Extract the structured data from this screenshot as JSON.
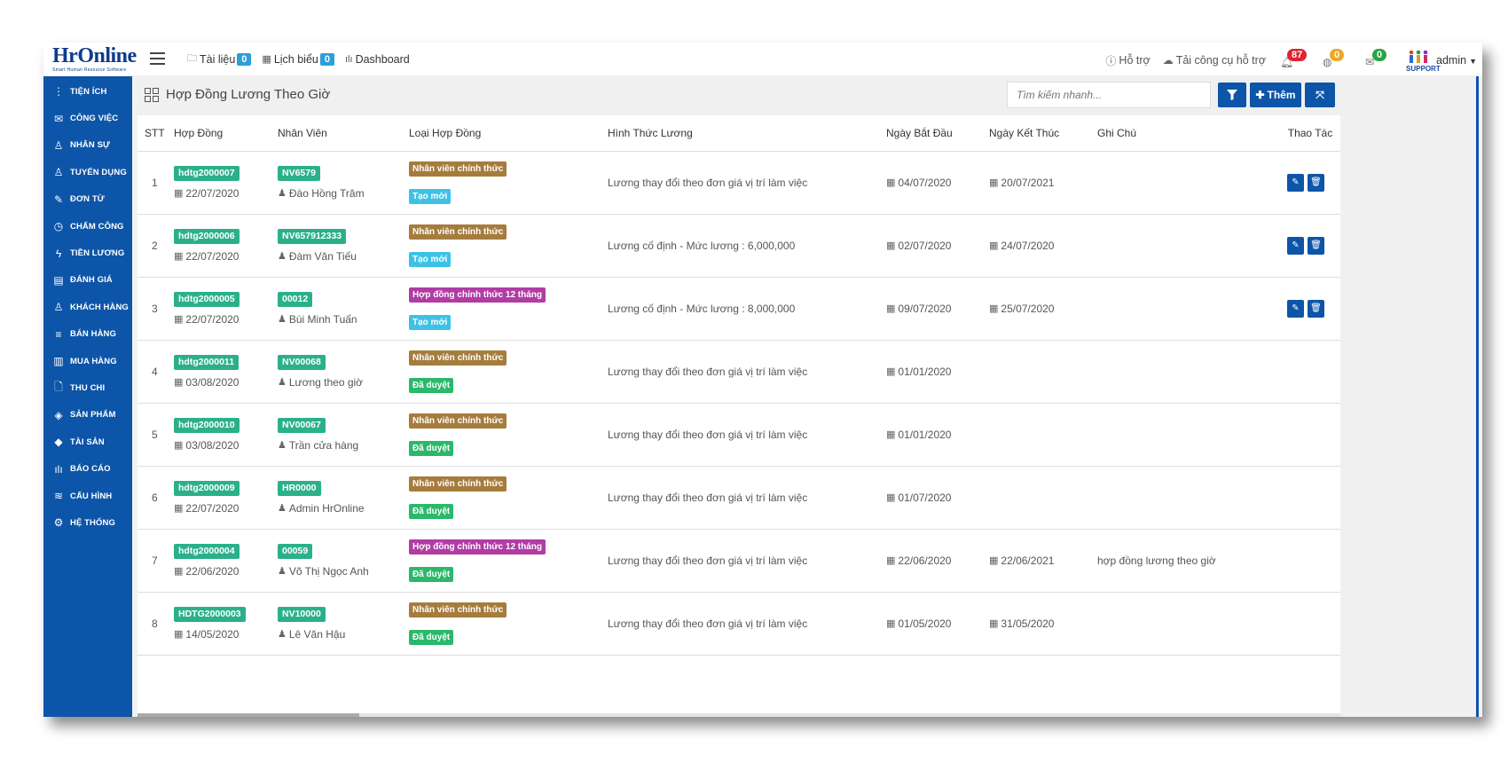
{
  "app": {
    "logo_text": "HrOnline",
    "logo_tagline": "Smart Human Resource Software"
  },
  "topnav": {
    "documents_label": "Tài liệu",
    "documents_count": "0",
    "forms_label": "Lịch biểu",
    "forms_count": "0",
    "dashboard_label": "Dashboard"
  },
  "topright": {
    "help_label": "Hỗ trợ",
    "tools_label": "Tải công cụ hỗ trợ",
    "notifications_count": "87",
    "globe_count": "0",
    "mail_count": "0",
    "support_label": "SUPPORT",
    "user_label": "admin"
  },
  "colors": {
    "brand": "#0d55a8",
    "badge_code": "#2bb08a",
    "badge_official": "#a67c3d",
    "badge_contract12": "#b03ca4",
    "badge_new": "#3ec1e5",
    "badge_approved": "#2bb86a",
    "notif_red": "#e0242f",
    "notif_orange": "#f0a722",
    "notif_green": "#27a642"
  },
  "sidebar": {
    "items": [
      {
        "label": "Tiện ích",
        "icon": "vertical-dots-icon"
      },
      {
        "label": "Công việc",
        "icon": "inbox-icon"
      },
      {
        "label": "Nhân sự",
        "icon": "user-icon"
      },
      {
        "label": "Tuyển dụng",
        "icon": "user-add-icon"
      },
      {
        "label": "Đơn từ",
        "icon": "edit-icon"
      },
      {
        "label": "Chấm công",
        "icon": "clock-icon"
      },
      {
        "label": "Tiền lương",
        "icon": "bolt-icon"
      },
      {
        "label": "Đánh giá",
        "icon": "book-icon"
      },
      {
        "label": "Khách hàng",
        "icon": "customer-icon"
      },
      {
        "label": "Bán hàng",
        "icon": "list-icon"
      },
      {
        "label": "Mua hàng",
        "icon": "map-icon"
      },
      {
        "label": "Thu chi",
        "icon": "file-icon"
      },
      {
        "label": "Sản phẩm",
        "icon": "tag-icon"
      },
      {
        "label": "Tài sản",
        "icon": "diamond-icon"
      },
      {
        "label": "Báo cáo",
        "icon": "bar-chart-icon"
      },
      {
        "label": "Cấu hình",
        "icon": "layers-icon"
      },
      {
        "label": "Hệ thống",
        "icon": "gear-icon"
      }
    ]
  },
  "page": {
    "title": "Hợp Đồng Lương Theo Giờ",
    "search_placeholder": "Tìm kiếm nhanh...",
    "add_label": "Thêm"
  },
  "table": {
    "headers": [
      "STT",
      "Hợp Đồng",
      "Nhân Viên",
      "Loại Hợp Đồng",
      "Hình Thức Lương",
      "Ngày Bắt Đầu",
      "Ngày Kết Thúc",
      "Ghi Chú",
      "Thao Tác"
    ],
    "rows": [
      {
        "stt": "1",
        "contract": "hdtg2000007",
        "contract_date": "22/07/2020",
        "emp_code": "NV6579",
        "emp_name": "Đào Hồng Trâm",
        "type": "Nhân viên chính thức",
        "type_kind": "official",
        "status": "Tạo mới",
        "status_kind": "new",
        "salary": "Lương thay đổi theo đơn giá vị trí làm việc",
        "start": "04/07/2020",
        "end": "20/07/2021",
        "note": "",
        "actions": true
      },
      {
        "stt": "2",
        "contract": "hdtg2000006",
        "contract_date": "22/07/2020",
        "emp_code": "NV657912333",
        "emp_name": "Đàm Văn Tiếu",
        "type": "Nhân viên chính thức",
        "type_kind": "official",
        "status": "Tạo mới",
        "status_kind": "new",
        "salary": "Lương cố định - Mức lương : 6,000,000",
        "start": "02/07/2020",
        "end": "24/07/2020",
        "note": "",
        "actions": true
      },
      {
        "stt": "3",
        "contract": "hdtg2000005",
        "contract_date": "22/07/2020",
        "emp_code": "00012",
        "emp_name": "Bùi Minh Tuấn",
        "type": "Hợp đồng chính thức 12 tháng",
        "type_kind": "contract12",
        "status": "Tạo mới",
        "status_kind": "new",
        "salary": "Lương cố định - Mức lương : 8,000,000",
        "start": "09/07/2020",
        "end": "25/07/2020",
        "note": "",
        "actions": true
      },
      {
        "stt": "4",
        "contract": "hdtg2000011",
        "contract_date": "03/08/2020",
        "emp_code": "NV00068",
        "emp_name": "Lương theo giờ",
        "type": "Nhân viên chính thức",
        "type_kind": "official",
        "status": "Đã duyệt",
        "status_kind": "approved",
        "salary": "Lương thay đổi theo đơn giá vị trí làm việc",
        "start": "01/01/2020",
        "end": "",
        "note": "",
        "actions": false
      },
      {
        "stt": "5",
        "contract": "hdtg2000010",
        "contract_date": "03/08/2020",
        "emp_code": "NV00067",
        "emp_name": "Trần cửa hàng",
        "type": "Nhân viên chính thức",
        "type_kind": "official",
        "status": "Đã duyệt",
        "status_kind": "approved",
        "salary": "Lương thay đổi theo đơn giá vị trí làm việc",
        "start": "01/01/2020",
        "end": "",
        "note": "",
        "actions": false
      },
      {
        "stt": "6",
        "contract": "hdtg2000009",
        "contract_date": "22/07/2020",
        "emp_code": "HR0000",
        "emp_name": "Admin HrOnline",
        "type": "Nhân viên chính thức",
        "type_kind": "official",
        "status": "Đã duyệt",
        "status_kind": "approved",
        "salary": "Lương thay đổi theo đơn giá vị trí làm việc",
        "start": "01/07/2020",
        "end": "",
        "note": "",
        "actions": false
      },
      {
        "stt": "7",
        "contract": "hdtg2000004",
        "contract_date": "22/06/2020",
        "emp_code": "00059",
        "emp_name": "Võ Thị Ngọc Anh",
        "type": "Hợp đồng chính thức 12 tháng",
        "type_kind": "contract12",
        "status": "Đã duyệt",
        "status_kind": "approved",
        "salary": "Lương thay đổi theo đơn giá vị trí làm việc",
        "start": "22/06/2020",
        "end": "22/06/2021",
        "note": "hợp đồng lương theo giờ",
        "actions": false
      },
      {
        "stt": "8",
        "contract": "HDTG2000003",
        "contract_date": "14/05/2020",
        "emp_code": "NV10000",
        "emp_name": "Lê Văn Hậu",
        "type": "Nhân viên chính thức",
        "type_kind": "official",
        "status": "Đã duyệt",
        "status_kind": "approved",
        "salary": "Lương thay đổi theo đơn giá vị trí làm việc",
        "start": "01/05/2020",
        "end": "31/05/2020",
        "note": "",
        "actions": false
      }
    ]
  }
}
